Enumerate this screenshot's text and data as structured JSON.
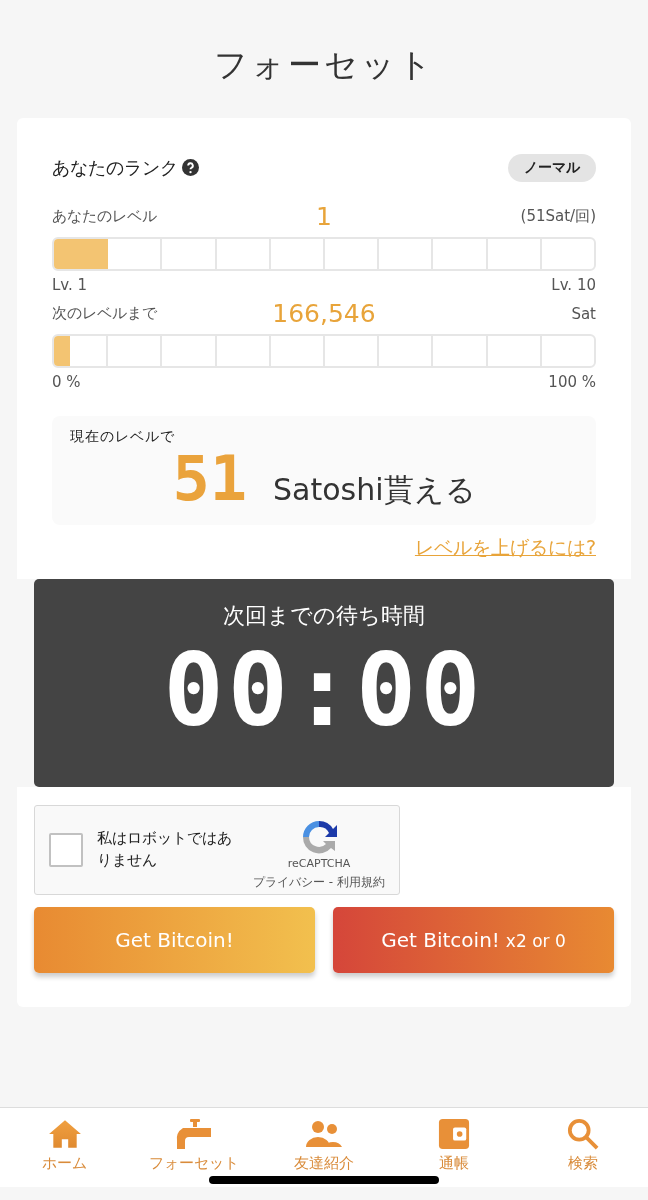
{
  "page_title": "フォーセット",
  "rank": {
    "label": "あなたのランク",
    "badge": "ノーマル"
  },
  "level_meter": {
    "label": "あなたのレベル",
    "value": "1",
    "unit": "(51Sat/回)",
    "level": 0.1,
    "min_label": "Lv. 1",
    "max_label": "Lv. 10"
  },
  "next_meter": {
    "label": "次のレベルまで",
    "value": "166,546",
    "unit": "Sat",
    "level": 0.03,
    "min_label": "0 %",
    "max_label": "100 %"
  },
  "reward": {
    "caption": "現在のレベルで",
    "amount": "51",
    "unit": "Satoshi貰える"
  },
  "help_link": "レベルを上げるには?",
  "timer": {
    "title": "次回までの待ち時間",
    "time": "00:00"
  },
  "captcha": {
    "checked": false,
    "label": "私はロボットではありません",
    "brand": "reCAPTCHA",
    "links": "プライバシー - 利用規約"
  },
  "buttons": [
    {
      "label": "Get Bitcoin!",
      "kind": "normal"
    },
    {
      "label": "Get Bitcoin!",
      "suffix": "x2 or 0",
      "kind": "double"
    }
  ],
  "nav": [
    {
      "label": "ホーム",
      "kind": "home"
    },
    {
      "label": "フォーセット",
      "kind": "faucet"
    },
    {
      "label": "友達紹介",
      "kind": "friends"
    },
    {
      "label": "通帳",
      "kind": "wallet"
    },
    {
      "label": "検索",
      "kind": "search"
    }
  ]
}
